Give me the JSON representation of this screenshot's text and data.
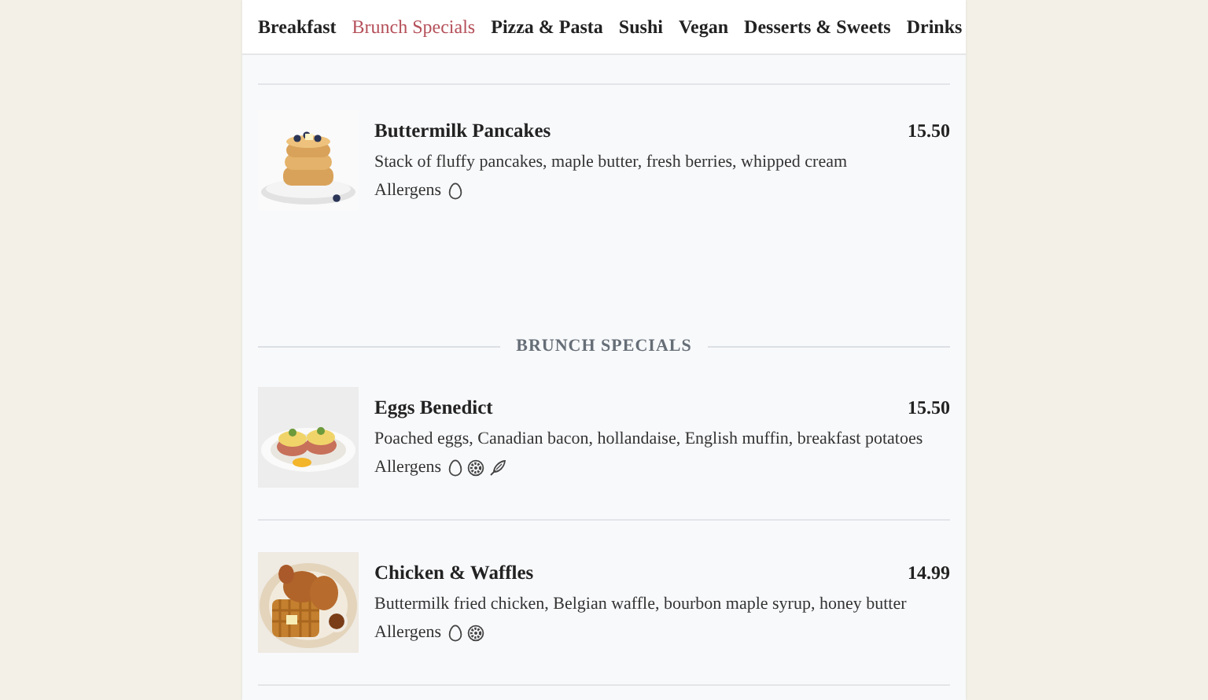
{
  "tabs": [
    {
      "label": "Breakfast",
      "selected": false
    },
    {
      "label": "Brunch Specials",
      "selected": true
    },
    {
      "label": "Pizza & Pasta",
      "selected": false
    },
    {
      "label": "Sushi",
      "selected": false
    },
    {
      "label": "Vegan",
      "selected": false
    },
    {
      "label": "Desserts & Sweets",
      "selected": false
    },
    {
      "label": "Drinks",
      "selected": false
    }
  ],
  "sections": [
    {
      "items": [
        {
          "name": "Buttermilk Pancakes",
          "price": "15.50",
          "description": "Stack of fluffy pancakes, maple butter, fresh berries, whipped cream",
          "allergens_label": "Allergens",
          "allergens": [
            {
              "kind": "egg"
            }
          ],
          "image": {
            "kind": "picture"
          }
        }
      ]
    },
    {
      "title": "BRUNCH SPECIALS",
      "items": [
        {
          "name": "Eggs Benedict",
          "price": "15.50",
          "description": "Poached eggs, Canadian bacon, hollandaise, English muffin, breakfast potatoes",
          "allergens_label": "Allergens",
          "allergens": [
            {
              "kind": "egg"
            },
            {
              "kind": "gluten"
            },
            {
              "kind": "feather"
            }
          ],
          "image": {
            "kind": "picture"
          }
        },
        {
          "name": "Chicken & Waffles",
          "price": "14.99",
          "description": "Buttermilk fried chicken, Belgian waffle, bourbon maple syrup, honey butter",
          "allergens_label": "Allergens",
          "allergens": [
            {
              "kind": "egg"
            },
            {
              "kind": "gluten"
            }
          ],
          "image": {
            "kind": "picture"
          }
        }
      ]
    }
  ]
}
